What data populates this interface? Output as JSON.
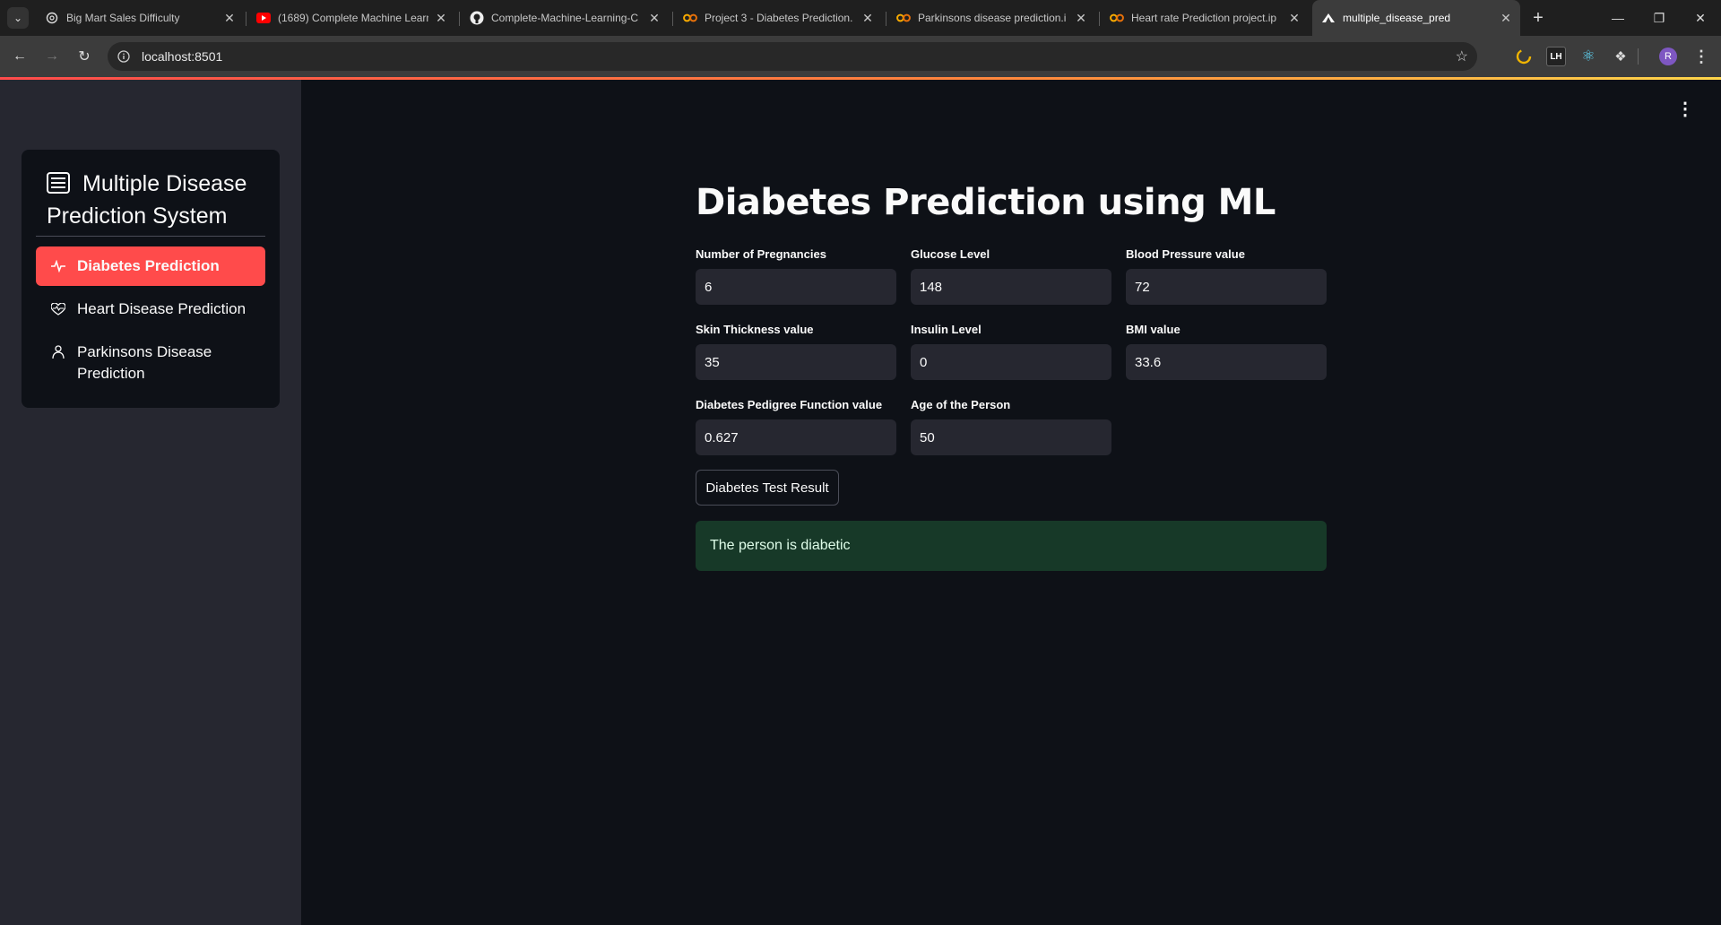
{
  "browser": {
    "tabs": [
      {
        "title": "Big Mart Sales Difficulty",
        "icon": "chatgpt-icon",
        "active": false
      },
      {
        "title": "(1689) Complete Machine Learn",
        "icon": "youtube-icon",
        "active": false
      },
      {
        "title": "Complete-Machine-Learning-C",
        "icon": "github-icon",
        "active": false
      },
      {
        "title": "Project 3 - Diabetes Prediction.",
        "icon": "colab-icon",
        "active": false
      },
      {
        "title": "Parkinsons disease prediction.i",
        "icon": "colab-icon",
        "active": false
      },
      {
        "title": "Heart rate Prediction project.ip",
        "icon": "colab-icon",
        "active": false
      },
      {
        "title": "multiple_disease_pred",
        "icon": "streamlit-icon",
        "active": true
      }
    ],
    "url": "localhost:8501",
    "profile_initial": "R",
    "extensions": [
      {
        "icon": "extension-clock-icon",
        "label": ""
      },
      {
        "icon": "extension-lh-icon",
        "label": "LH"
      },
      {
        "icon": "react-devtools-icon",
        "label": ""
      },
      {
        "icon": "puzzle-icon",
        "label": ""
      }
    ]
  },
  "sidebar": {
    "title": "Multiple Disease Prediction System",
    "items": [
      {
        "label": "Diabetes Prediction",
        "icon": "activity-icon",
        "active": true
      },
      {
        "label": "Heart Disease Prediction",
        "icon": "heart-pulse-icon",
        "active": false
      },
      {
        "label": "Parkinsons Disease Prediction",
        "icon": "person-icon",
        "active": false
      }
    ]
  },
  "main": {
    "title": "Diabetes Prediction using ML",
    "fields": [
      {
        "label": "Number of Pregnancies",
        "value": "6"
      },
      {
        "label": "Glucose Level",
        "value": "148"
      },
      {
        "label": "Blood Pressure value",
        "value": "72"
      },
      {
        "label": "Skin Thickness value",
        "value": "35"
      },
      {
        "label": "Insulin Level",
        "value": "0"
      },
      {
        "label": "BMI value",
        "value": "33.6"
      },
      {
        "label": "Diabetes Pedigree Function value",
        "value": "0.627"
      },
      {
        "label": "Age of the Person",
        "value": "50"
      }
    ],
    "button_label": "Diabetes Test Result",
    "result_text": "The person is diabetic"
  },
  "colors": {
    "accent": "#ff4b4b",
    "sidebar_bg": "#262730",
    "main_bg": "#0e1117",
    "success_bg": "#173928"
  }
}
